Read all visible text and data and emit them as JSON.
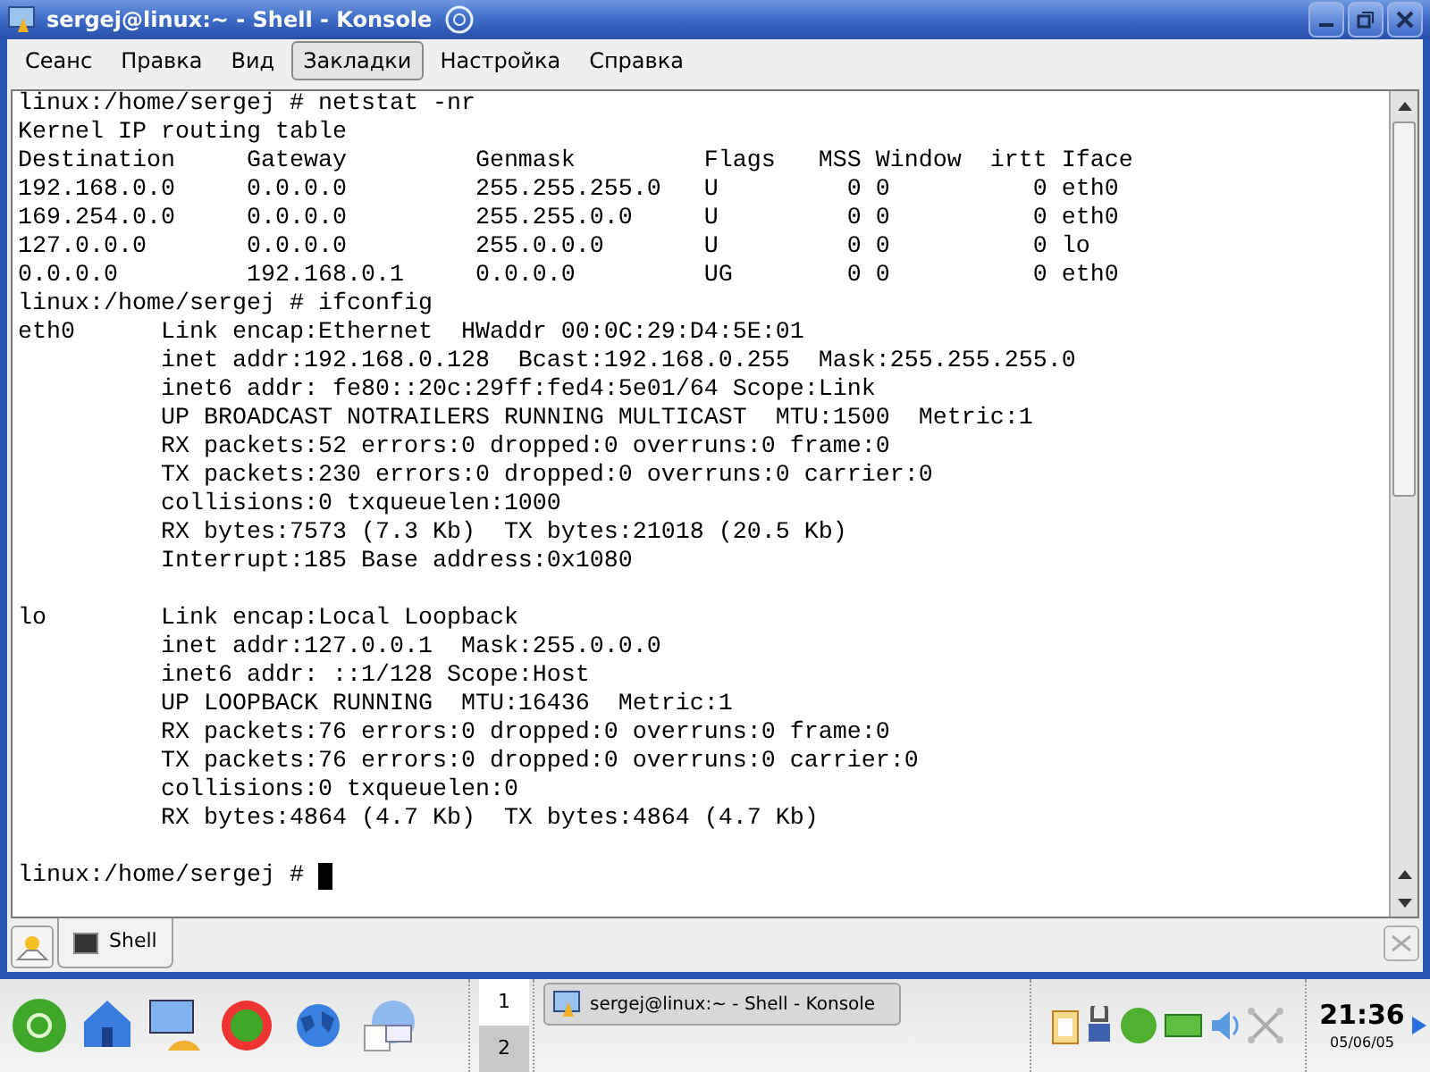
{
  "window": {
    "title": "sergej@linux:~ - Shell - Konsole"
  },
  "menu": [
    {
      "label": "Сеанс",
      "selected": false
    },
    {
      "label": "Правка",
      "selected": false
    },
    {
      "label": "Вид",
      "selected": false
    },
    {
      "label": "Закладки",
      "selected": true
    },
    {
      "label": "Настройка",
      "selected": false
    },
    {
      "label": "Справка",
      "selected": false
    }
  ],
  "terminal": {
    "lines": [
      {
        "kind": "text",
        "text": "linux:/home/sergej # netstat -nr"
      },
      {
        "kind": "text",
        "text": "Kernel IP routing table"
      },
      {
        "kind": "text",
        "text": "Destination     Gateway         Genmask         Flags   MSS Window  irtt Iface"
      },
      {
        "kind": "text",
        "text": "192.168.0.0     0.0.0.0         255.255.255.0   U         0 0          0 eth0"
      },
      {
        "kind": "text",
        "text": "169.254.0.0     0.0.0.0         255.255.0.0     U         0 0          0 eth0"
      },
      {
        "kind": "text",
        "text": "127.0.0.0       0.0.0.0         255.0.0.0       U         0 0          0 lo"
      },
      {
        "kind": "text",
        "text": "0.0.0.0         192.168.0.1     0.0.0.0         UG        0 0          0 eth0"
      },
      {
        "kind": "text",
        "text": "linux:/home/sergej # ifconfig"
      },
      {
        "kind": "text",
        "text": "eth0      Link encap:Ethernet  HWaddr 00:0C:29:D4:5E:01"
      },
      {
        "kind": "text",
        "text": "          inet addr:192.168.0.128  Bcast:192.168.0.255  Mask:255.255.255.0"
      },
      {
        "kind": "text",
        "text": "          inet6 addr: fe80::20c:29ff:fed4:5e01/64 Scope:Link"
      },
      {
        "kind": "text",
        "text": "          UP BROADCAST NOTRAILERS RUNNING MULTICAST  MTU:1500  Metric:1"
      },
      {
        "kind": "text",
        "text": "          RX packets:52 errors:0 dropped:0 overruns:0 frame:0"
      },
      {
        "kind": "text",
        "text": "          TX packets:230 errors:0 dropped:0 overruns:0 carrier:0"
      },
      {
        "kind": "text",
        "text": "          collisions:0 txqueuelen:1000"
      },
      {
        "kind": "text",
        "text": "          RX bytes:7573 (7.3 Kb)  TX bytes:21018 (20.5 Kb)"
      },
      {
        "kind": "text",
        "text": "          Interrupt:185 Base address:0x1080"
      },
      {
        "kind": "blank"
      },
      {
        "kind": "text",
        "text": "lo        Link encap:Local Loopback"
      },
      {
        "kind": "text",
        "text": "          inet addr:127.0.0.1  Mask:255.0.0.0"
      },
      {
        "kind": "text",
        "text": "          inet6 addr: ::1/128 Scope:Host"
      },
      {
        "kind": "text",
        "text": "          UP LOOPBACK RUNNING  MTU:16436  Metric:1"
      },
      {
        "kind": "text",
        "text": "          RX packets:76 errors:0 dropped:0 overruns:0 frame:0"
      },
      {
        "kind": "text",
        "text": "          TX packets:76 errors:0 dropped:0 overruns:0 carrier:0"
      },
      {
        "kind": "text",
        "text": "          collisions:0 txqueuelen:0"
      },
      {
        "kind": "text",
        "text": "          RX bytes:4864 (4.7 Kb)  TX bytes:4864 (4.7 Kb)"
      },
      {
        "kind": "blank"
      },
      {
        "kind": "prompt",
        "text": "linux:/home/sergej # "
      }
    ]
  },
  "session_tabs": [
    {
      "label": "Shell",
      "selected": true
    }
  ],
  "taskbar": {
    "desktops": [
      {
        "label": "1",
        "selected": true
      },
      {
        "label": "2",
        "selected": false
      }
    ],
    "tasks": [
      {
        "label": "sergej@linux:~ - Shell - Konsole"
      }
    ],
    "clock": {
      "time": "21:36",
      "date": "05/06/05"
    }
  }
}
